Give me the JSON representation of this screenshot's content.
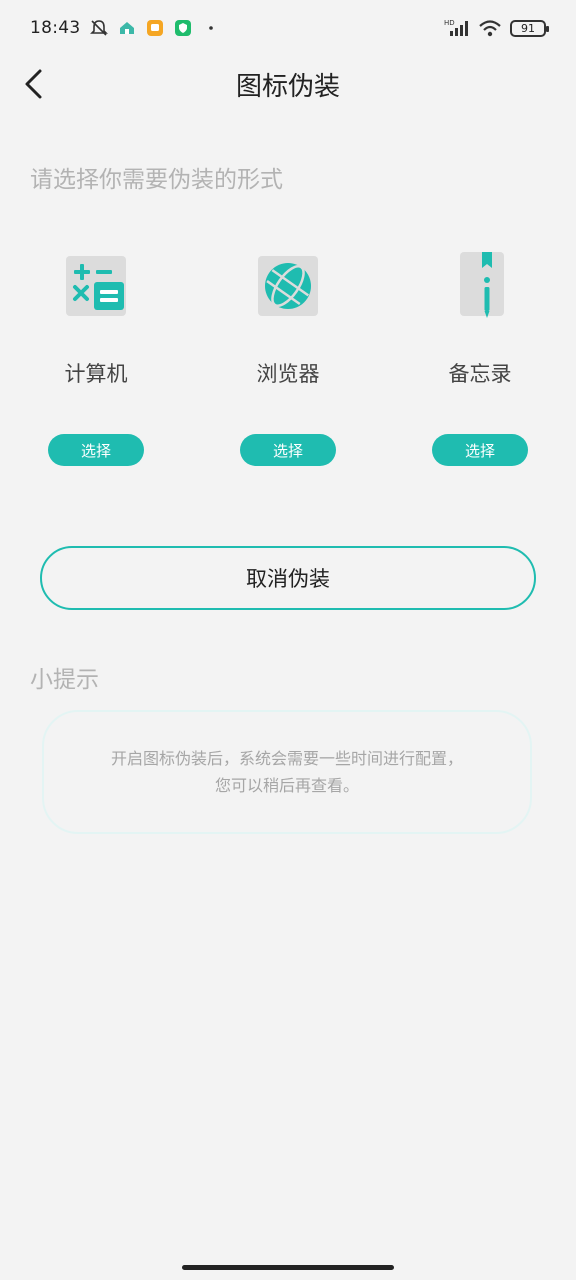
{
  "status_bar": {
    "time": "18:43",
    "battery": "91",
    "network_label": "HD"
  },
  "header": {
    "title": "图标伪装"
  },
  "section": {
    "label": "请选择你需要伪装的形式"
  },
  "options": [
    {
      "label": "计算机",
      "icon": "calculator-icon",
      "button": "选择"
    },
    {
      "label": "浏览器",
      "icon": "globe-icon",
      "button": "选择"
    },
    {
      "label": "备忘录",
      "icon": "notebook-icon",
      "button": "选择"
    }
  ],
  "cancel": {
    "label": "取消伪装"
  },
  "tips": {
    "title": "小提示",
    "text_line1": "开启图标伪装后，系统会需要一些时间进行配置，",
    "text_line2": "您可以稍后再查看。"
  },
  "colors": {
    "accent": "#1fbcb0",
    "background": "#f3f3f3",
    "muted_text": "#b3b3b3"
  }
}
